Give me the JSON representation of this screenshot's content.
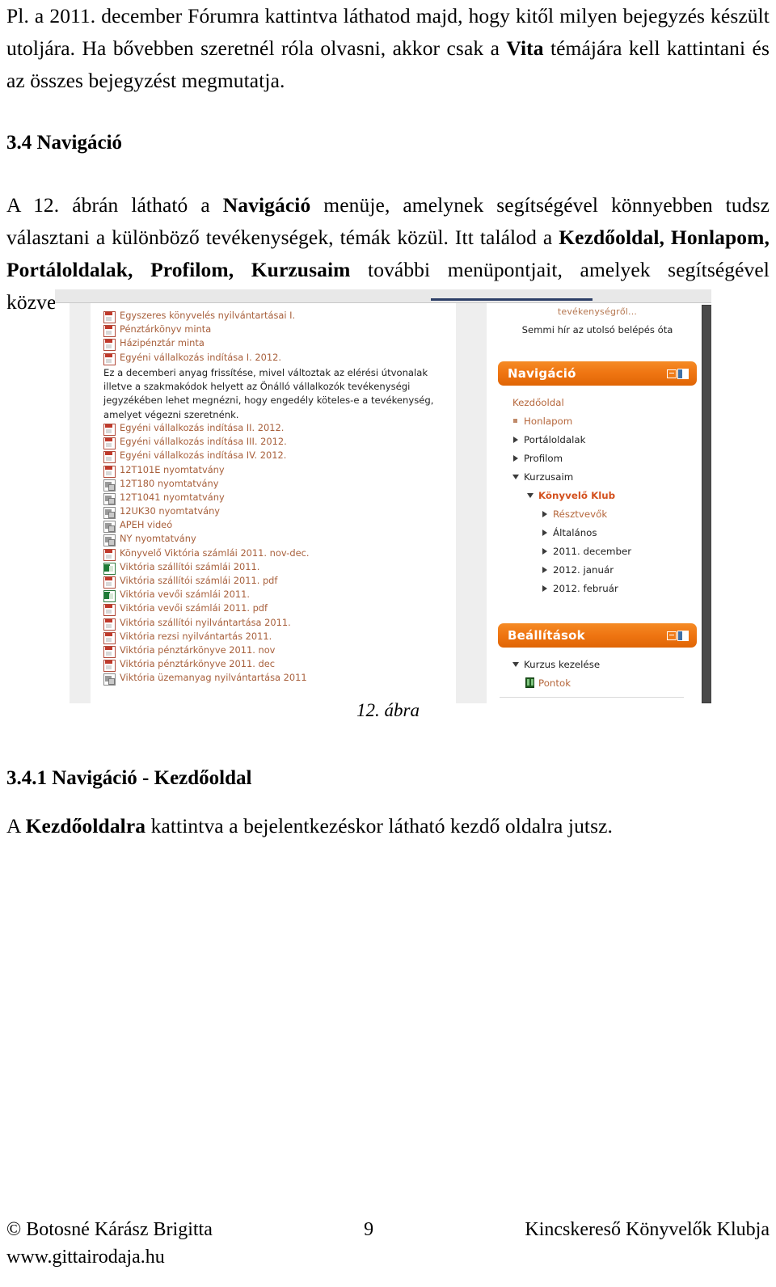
{
  "document": {
    "paragraph_1_parts": {
      "a": "Pl. a 2011. december Fórumra kattintva láthatod majd, hogy kitől milyen bejegyzés készült utoljára. Ha bővebben szeretnél róla olvasni, akkor csak a ",
      "bold": "Vita",
      "b": " témájára kell kattintani és az összes bejegyzést megmutatja."
    },
    "heading_3_4": "3.4 Navigáció",
    "paragraph_2_parts": {
      "a": "A 12. ábrán látható a ",
      "bold1": "Navigáció",
      "b": " menüje, amelynek segítségével könnyebben tudsz választani a különböző tevékenységek, témák közül. Itt találod a ",
      "bold2": "Kezdőoldal, Honlapom, Portáloldalak, Profilom, Kurzusaim",
      "c": " további menüpontjait, amelyek segítségével közvetlenül a kiválasztott oldalra jutsz."
    },
    "figure_caption": "12. ábra",
    "heading_3_4_1": "3.4.1 Navigáció - Kezdőoldal",
    "paragraph_3_parts": {
      "a": "A ",
      "bold": "Kezdőoldalra",
      "b": " kattintva a bejelentkezéskor látható kezdő oldalra jutsz."
    }
  },
  "footer": {
    "left_line1": "© Botosné Kárász Brigitta",
    "left_line2": "www.gittairodaja.hu",
    "page_number": "9",
    "right": "Kincskereső Könyvelők Klubja"
  },
  "figure": {
    "file_list": [
      {
        "icon": "pdf-icon",
        "label": "Egyszeres könyvelés nyilvántartásai I."
      },
      {
        "icon": "pdf-icon",
        "label": "Pénztárkönyv minta"
      },
      {
        "icon": "pdf-icon",
        "label": "Házipénztár minta"
      },
      {
        "icon": "pdf-icon",
        "label": "Egyéni vállalkozás indítása I. 2012."
      }
    ],
    "note": "Ez a decemberi anyag frissítése, mivel változtak az elérési útvonalak illetve a szakmakódok helyett az Önálló vállalkozók tevékenységi jegyzékében lehet megnézni, hogy engedély köteles-e a tevékenység, amelyet végezni szeretnénk.",
    "file_list_2": [
      {
        "icon": "pdf-icon",
        "label": "Egyéni vállalkozás indítása II. 2012."
      },
      {
        "icon": "pdf-icon",
        "label": "Egyéni vállalkozás indítása III. 2012."
      },
      {
        "icon": "pdf-icon",
        "label": "Egyéni vállalkozás indítása IV. 2012."
      },
      {
        "icon": "pdf-icon",
        "label": "12T101E nyomtatvány"
      },
      {
        "icon": "video-icon",
        "label": "12T180 nyomtatvány"
      },
      {
        "icon": "video-icon",
        "label": "12T1041 nyomtatvány"
      },
      {
        "icon": "video-icon",
        "label": "12UK30 nyomtatvány"
      },
      {
        "icon": "video-icon",
        "label": "APEH videó"
      },
      {
        "icon": "video-icon",
        "label": "NY nyomtatvány"
      },
      {
        "icon": "pdf-icon",
        "label": "Könyvelő Viktória számlái 2011. nov-dec."
      },
      {
        "icon": "excel-icon",
        "label": "Viktória szállítói számlái 2011."
      },
      {
        "icon": "pdf-icon",
        "label": "Viktória szállítói számlái 2011. pdf"
      },
      {
        "icon": "excel-icon",
        "label": "Viktória vevői számlái 2011."
      },
      {
        "icon": "pdf-icon",
        "label": "Viktória vevői számlái 2011. pdf"
      },
      {
        "icon": "pdf-icon",
        "label": "Viktória szállítói nyilvántartása 2011."
      },
      {
        "icon": "pdf-icon",
        "label": "Viktória rezsi nyilvántartás 2011."
      },
      {
        "icon": "pdf-icon",
        "label": "Viktória pénztárkönyve 2011. nov"
      },
      {
        "icon": "pdf-icon",
        "label": "Viktória pénztárkönyve 2011. dec"
      },
      {
        "icon": "video-icon",
        "label": "Viktória üzemanyag nyilvántartása 2011"
      }
    ],
    "news": {
      "top_fragment": "tevékenységről...",
      "message": "Semmi hír az utolsó belépés óta"
    },
    "nav_block": {
      "title": "Navigáció",
      "items": [
        {
          "label": "Kezdőoldal",
          "marker": "none",
          "level": 0,
          "style": "link"
        },
        {
          "label": "Honlapom",
          "marker": "square",
          "level": 1,
          "style": "link"
        },
        {
          "label": "Portáloldalak",
          "marker": "collapsed",
          "level": 1,
          "style": "plain"
        },
        {
          "label": "Profilom",
          "marker": "collapsed",
          "level": 1,
          "style": "plain"
        },
        {
          "label": "Kurzusaim",
          "marker": "expanded",
          "level": 1,
          "style": "plain"
        },
        {
          "label": "Könyvelő Klub",
          "marker": "expanded",
          "level": 2,
          "style": "bold-link"
        },
        {
          "label": "Résztvevők",
          "marker": "collapsed",
          "level": 3,
          "style": "link"
        },
        {
          "label": "Általános",
          "marker": "collapsed",
          "level": 3,
          "style": "plain"
        },
        {
          "label": "2011. december",
          "marker": "collapsed",
          "level": 3,
          "style": "plain"
        },
        {
          "label": "2012. január",
          "marker": "collapsed",
          "level": 3,
          "style": "plain"
        },
        {
          "label": "2012. február",
          "marker": "collapsed",
          "level": 3,
          "style": "plain"
        }
      ]
    },
    "settings_block": {
      "title": "Beállítások",
      "items": [
        {
          "label": "Kurzus kezelése",
          "marker": "expanded",
          "level": 1,
          "style": "plain"
        },
        {
          "label": "Pontok",
          "marker": "grid",
          "level": 2,
          "style": "link"
        }
      ]
    },
    "colors": {
      "block_header_orange": "#ef7512",
      "link_brown": "#b5673c",
      "bold_link_orange": "#d4511e",
      "scrollbar_dark": "#4a4a4a",
      "rail_gray": "#eeeeee"
    }
  }
}
